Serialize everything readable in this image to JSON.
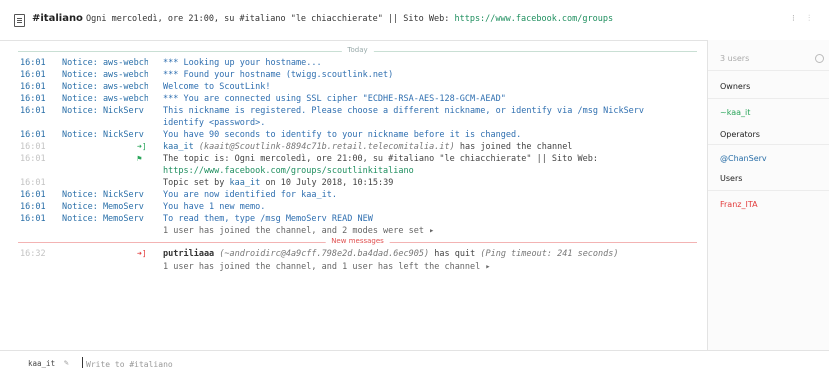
{
  "header": {
    "channel": "#italiano",
    "topic": "Ogni mercoledì, ore 21:00, su #italiano \"le chiacchierate\" || Sito Web:",
    "topic_url": "https://www.facebook.com/groups"
  },
  "separators": {
    "today": "Today",
    "new_messages": "New messages"
  },
  "messages": [
    {
      "time": "16:01",
      "nick": "Notice: aws-webch",
      "text": "*** Looking up your hostname..."
    },
    {
      "time": "16:01",
      "nick": "Notice: aws-webch",
      "text": "*** Found your hostname (twigg.scoutlink.net)"
    },
    {
      "time": "16:01",
      "nick": "Notice: aws-webch",
      "text": "Welcome to ScoutLink!"
    },
    {
      "time": "16:01",
      "nick": "Notice: aws-webch",
      "text": "*** You are connected using SSL cipher \"ECDHE-RSA-AES-128-GCM-AEAD\""
    },
    {
      "time": "16:01",
      "nick": "Notice: NickServ",
      "text": "This nickname is registered. Please choose a different nickname, or identify via /msg NickServ",
      "text2": "identify <password>."
    },
    {
      "time": "16:01",
      "nick": "Notice: NickServ",
      "text": "You have 90 seconds to identify to your nickname before it is changed."
    },
    {
      "time": "16:01",
      "join_nick": "kaa_it",
      "join_host": "(kaait@Scoutlink-8894c71b.retail.telecomitalia.it)",
      "join_suffix": "has joined the channel"
    },
    {
      "time": "16:01",
      "text": "The topic is: Ogni mercoledì, ore 21:00, su #italiano \"le chiacchierate\" || Sito Web:",
      "text2": "https://www.facebook.com/groups/scoutlinkitaliano"
    },
    {
      "time": "16:01",
      "setby_prefix": "Topic set by",
      "setby_nick": "kaa_it",
      "setby_suffix": "on 10 July 2018, 10:15:39"
    },
    {
      "time": "16:01",
      "nick": "Notice: NickServ",
      "text": "You are now identified for kaa_it."
    },
    {
      "time": "16:01",
      "nick": "Notice: MemoServ",
      "text": "You have 1 new memo."
    },
    {
      "time": "16:01",
      "nick": "Notice: MemoServ",
      "text": "To read them, type /msg MemoServ READ NEW"
    },
    {
      "text": "1 user has joined the channel, and 2 modes were set ▸"
    },
    {
      "time": "16:32",
      "quit_nick": "putriliaaa",
      "quit_host": "(~androidirc@4a9cff.798e2d.ba4dad.6ec905)",
      "quit_mid": "has quit",
      "quit_reason": "(Ping timeout: 241 seconds)"
    },
    {
      "text": "1 user has joined the channel, and 1 user has left the channel ▸"
    }
  ],
  "sidebar": {
    "users_count": "3 users",
    "owners_label": "Owners",
    "owner": "~kaa_it",
    "operators_label": "Operators",
    "operator": "@ChanServ",
    "users_label": "Users",
    "user": "Franz_ITA"
  },
  "input": {
    "nick": "kaa_it",
    "placeholder": "Write to #italiano"
  },
  "colors": {
    "notice": "#2a6fa8",
    "join": "#2aa55a",
    "quit": "#e23b3b",
    "owner": "#2aa55a",
    "user": "#e23b3b"
  }
}
